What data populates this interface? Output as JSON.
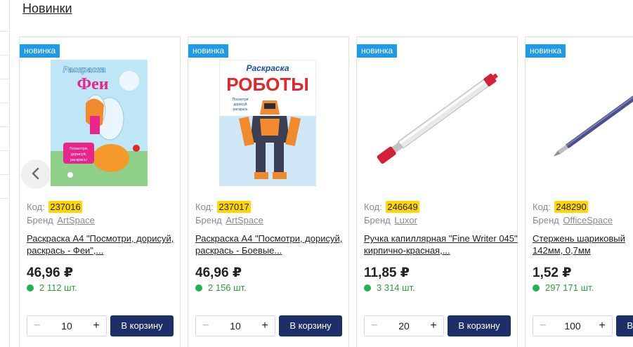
{
  "section": {
    "title": "Новинки"
  },
  "carousel": {
    "prev_icon": "chevron-left-icon"
  },
  "products": [
    {
      "badge": "новинка",
      "code_label": "Код:",
      "code": "237016",
      "brand_label": "Бренд",
      "brand": "ArtSpace",
      "title": "Раскраска А4 \"Посмотри, дорисуй, раскрась - Феи\",...",
      "price": "46,96 ₽",
      "stock": "2 112 шт.",
      "qty": "10",
      "cart_label": "В корзину",
      "image": {
        "kind": "book",
        "caption": "Раскраска",
        "headline": "Феи",
        "sub": "Посмотри, дорисуй, раскрась!",
        "accent": "#e8258a"
      }
    },
    {
      "badge": "новинка",
      "code_label": "Код:",
      "code": "237017",
      "brand_label": "Бренд",
      "brand": "ArtSpace",
      "title": "Раскраска А4 \"Посмотри, дорисуй, раскрась - Боевые...",
      "price": "46,96 ₽",
      "stock": "2 156 шт.",
      "qty": "10",
      "cart_label": "В корзину",
      "image": {
        "kind": "book",
        "caption": "Раскраска",
        "headline": "РОБОТЫ",
        "sub": "Посмотри, дорисуй, раскрась",
        "accent": "#e3262b"
      }
    },
    {
      "badge": "новинка",
      "code_label": "Код:",
      "code": "246649",
      "brand_label": "Бренд",
      "brand": "Luxor",
      "title": "Ручка капиллярная \"Fine Writer 045\" кирпично-красная,...",
      "price": "11,85 ₽",
      "stock": "3 314 шт.",
      "qty": "20",
      "cart_label": "В корзину",
      "image": {
        "kind": "pen",
        "cap": "#d4213a"
      }
    },
    {
      "badge": "новинка",
      "code_label": "Код:",
      "code": "248290",
      "brand_label": "Бренд",
      "brand": "OfficeSpace",
      "title": "Стержень шариковый 142мм, 0,7мм",
      "price": "1,52 ₽",
      "stock": "297 171 шт.",
      "qty": "100",
      "cart_label": "В корзину",
      "image": {
        "kind": "refill",
        "ink": "#4b4f8a"
      }
    }
  ],
  "colors": {
    "badge": "#1e9be8",
    "code_highlight": "#ffd600",
    "stock": "#2f9e3a",
    "cart_button": "#1c2f6b"
  }
}
